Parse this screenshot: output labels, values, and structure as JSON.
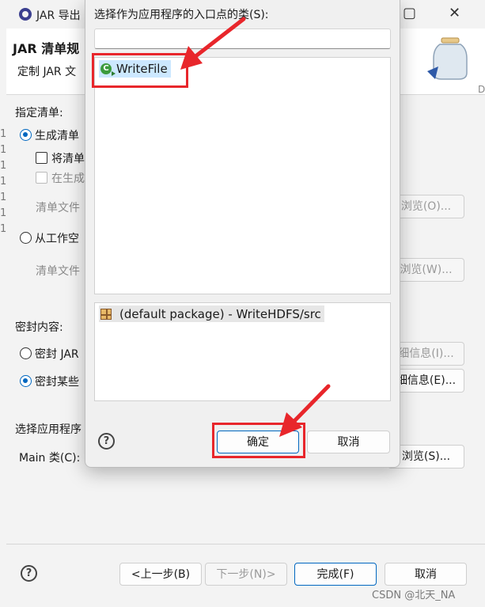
{
  "background_window": {
    "title": "JAR 导出",
    "header_title": "JAR 清单规",
    "header_subtitle": "定制 JAR 文",
    "edge_letter": "D",
    "specify_manifest_label": "指定清单:",
    "generate_manifest_radio": "生成清单",
    "save_manifest_check": "将清单",
    "reuse_check": "在生成",
    "manifest_file_label_1": "清单文件",
    "browse_o": "浏览(O)...",
    "from_workspace_radio": "从工作空",
    "manifest_file_label_2": "清单文件",
    "browse_w": "浏览(W)...",
    "seal_content_label": "密封内容:",
    "seal_jar_radio": "密封 JAR",
    "details_i": "细信息(I)...",
    "seal_some_radio": "密封某些",
    "details_e": "细信息(E)...",
    "select_app_label": "选择应用程序",
    "main_class_label": "Main 类(C):",
    "browse_s": "浏览(S)...",
    "line_numbers": [
      "1",
      "1",
      "1",
      "1",
      "1",
      "1",
      "1"
    ],
    "back_button": "<上一步(B)",
    "next_button": "下一步(N)>",
    "finish_button": "完成(F)",
    "cancel_button": "取消"
  },
  "dialog": {
    "prompt": "选择作为应用程序的入口点的类(S):",
    "filter_value": "",
    "class_list": [
      {
        "name": "WriteFile",
        "icon": "java-class-icon"
      }
    ],
    "package_list": [
      {
        "name": "(default package) - WriteHDFS/src",
        "icon": "package-icon"
      }
    ],
    "ok_button": "确定",
    "cancel_button": "取消"
  },
  "watermark": "CSDN @北天_NA",
  "colors": {
    "annotation_red": "#e8262b",
    "selection": "#cce8ff",
    "accent": "#0067c0"
  }
}
